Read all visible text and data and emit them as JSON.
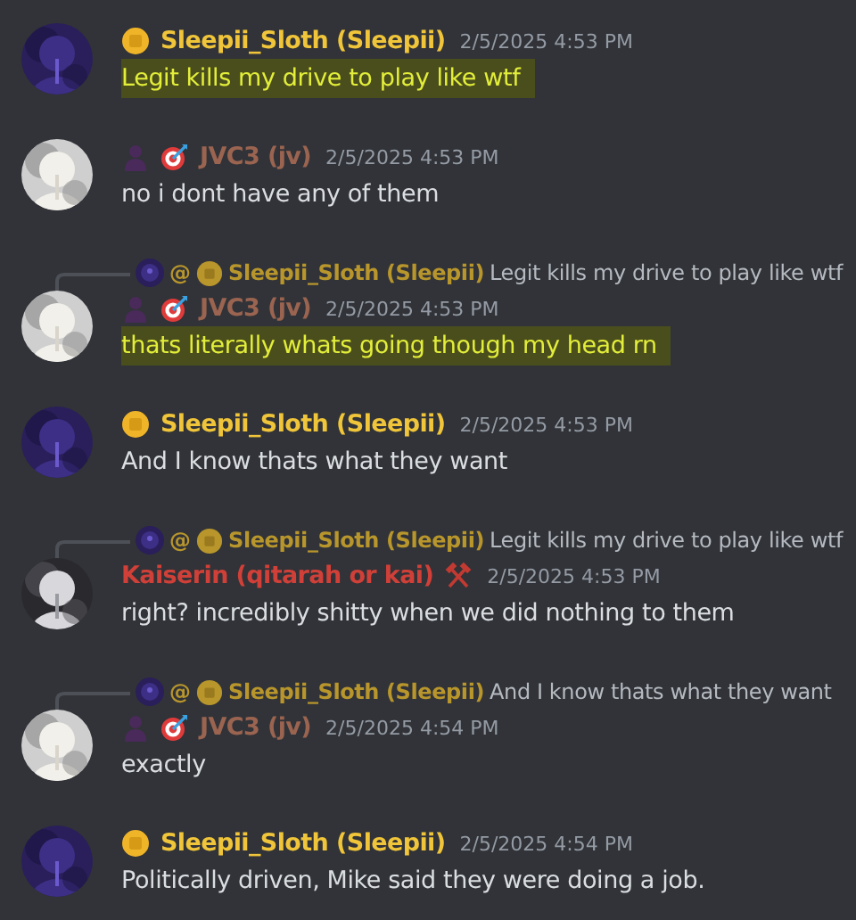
{
  "messages": [
    {
      "avatar": {
        "kind": "night"
      },
      "author": "Sleepii_Sloth (Sleepii)",
      "color": "#f0c53a",
      "badges": [
        {
          "kind": "coin"
        }
      ],
      "time": "2/5/2025 4:53 PM",
      "text": "Legit kills my drive to play like wtf",
      "highlighted": true
    },
    {
      "avatar": {
        "kind": "dog"
      },
      "author": "JVC3 (jv)",
      "color": "#9a6450",
      "badges": [
        {
          "kind": "person"
        },
        {
          "kind": "target"
        }
      ],
      "time": "2/5/2025 4:53 PM",
      "text": "no i dont have any of them",
      "highlighted": false
    },
    {
      "reply": {
        "avatar": {
          "kind": "night"
        },
        "mention": "@",
        "author": "Sleepii_Sloth (Sleepii)",
        "badges": [
          {
            "kind": "coin"
          }
        ],
        "text": "Legit kills my drive to play like wtf"
      },
      "avatar": {
        "kind": "dog"
      },
      "author": "JVC3 (jv)",
      "color": "#9a6450",
      "badges": [
        {
          "kind": "person"
        },
        {
          "kind": "target"
        }
      ],
      "time": "2/5/2025 4:53 PM",
      "text": "thats literally whats going though my head rn",
      "highlighted": true
    },
    {
      "avatar": {
        "kind": "night"
      },
      "author": "Sleepii_Sloth (Sleepii)",
      "color": "#f0c53a",
      "badges": [
        {
          "kind": "coin"
        }
      ],
      "time": "2/5/2025 4:53 PM",
      "text": "And I know thats what they want",
      "highlighted": false
    },
    {
      "reply": {
        "avatar": {
          "kind": "night"
        },
        "mention": "@",
        "author": "Sleepii_Sloth (Sleepii)",
        "badges": [
          {
            "kind": "coin"
          }
        ],
        "text": "Legit kills my drive to play like wtf"
      },
      "avatar": {
        "kind": "figure"
      },
      "author": "Kaiserin (qitarah or kai)",
      "color": "#d04038",
      "badges_after": [
        {
          "kind": "hammers"
        }
      ],
      "time": "2/5/2025 4:53 PM",
      "text": "right? incredibly shitty when we did nothing to them",
      "highlighted": false
    },
    {
      "reply": {
        "avatar": {
          "kind": "night"
        },
        "mention": "@",
        "author": "Sleepii_Sloth (Sleepii)",
        "badges": [
          {
            "kind": "coin"
          }
        ],
        "text": "And I know thats what they want"
      },
      "avatar": {
        "kind": "dog"
      },
      "author": "JVC3 (jv)",
      "color": "#9a6450",
      "badges": [
        {
          "kind": "person"
        },
        {
          "kind": "target"
        }
      ],
      "time": "2/5/2025 4:54 PM",
      "text": "exactly",
      "highlighted": false
    },
    {
      "avatar": {
        "kind": "night"
      },
      "author": "Sleepii_Sloth (Sleepii)",
      "color": "#f0c53a",
      "badges": [
        {
          "kind": "coin"
        }
      ],
      "time": "2/5/2025 4:54 PM",
      "text": "Politically driven, Mike said they were doing a job.",
      "highlighted": false
    }
  ]
}
